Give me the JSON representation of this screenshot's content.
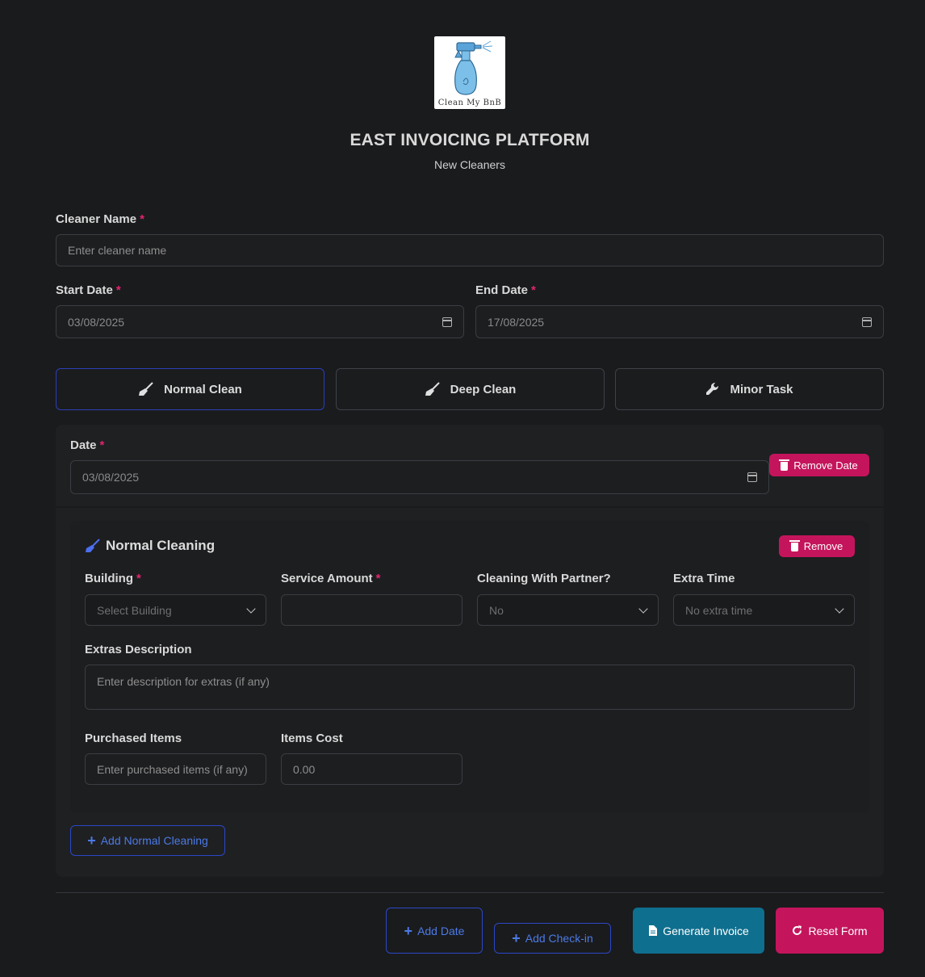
{
  "header": {
    "logo_text": "Clean My BnB",
    "title": "EAST INVOICING PLATFORM",
    "subtitle": "New Cleaners"
  },
  "form": {
    "cleaner_name": {
      "label": "Cleaner Name",
      "required": "*",
      "placeholder": "Enter cleaner name",
      "value": ""
    },
    "start_date": {
      "label": "Start Date",
      "required": "*",
      "value": "03/08/2025"
    },
    "end_date": {
      "label": "End Date",
      "required": "*",
      "value": "17/08/2025"
    }
  },
  "tabs": [
    {
      "label": "Normal Clean",
      "icon": "broom-icon",
      "active": true
    },
    {
      "label": "Deep Clean",
      "icon": "broom-icon",
      "active": false
    },
    {
      "label": "Minor Task",
      "icon": "wrench-icon",
      "active": false
    }
  ],
  "date_section": {
    "label": "Date",
    "required": "*",
    "value": "03/08/2025",
    "remove_label": "Remove Date"
  },
  "cleaning_card": {
    "title": "Normal Cleaning",
    "remove_label": "Remove",
    "building": {
      "label": "Building",
      "required": "*",
      "selected": "Select Building"
    },
    "service_amount": {
      "label": "Service Amount",
      "required": "*",
      "value": ""
    },
    "partner": {
      "label": "Cleaning With Partner?",
      "selected": "No"
    },
    "extra_time": {
      "label": "Extra Time",
      "selected": "No extra time"
    },
    "extras_description": {
      "label": "Extras Description",
      "placeholder": "Enter description for extras (if any)"
    },
    "purchased_items": {
      "label": "Purchased Items",
      "placeholder": "Enter purchased items (if any)"
    },
    "items_cost": {
      "label": "Items Cost",
      "placeholder": "0.00"
    }
  },
  "add_normal_cleaning_label": "Add Normal Cleaning",
  "footer": {
    "add_date_label": "Add Date",
    "add_checkin_label": "Add Check-in",
    "generate_invoice_label": "Generate Invoice",
    "reset_form_label": "Reset Form"
  },
  "colors": {
    "accent_pink": "#c4155c",
    "accent_teal": "#0f6f8f",
    "accent_blue": "#4c7ae6",
    "background": "#1a1b1d"
  }
}
